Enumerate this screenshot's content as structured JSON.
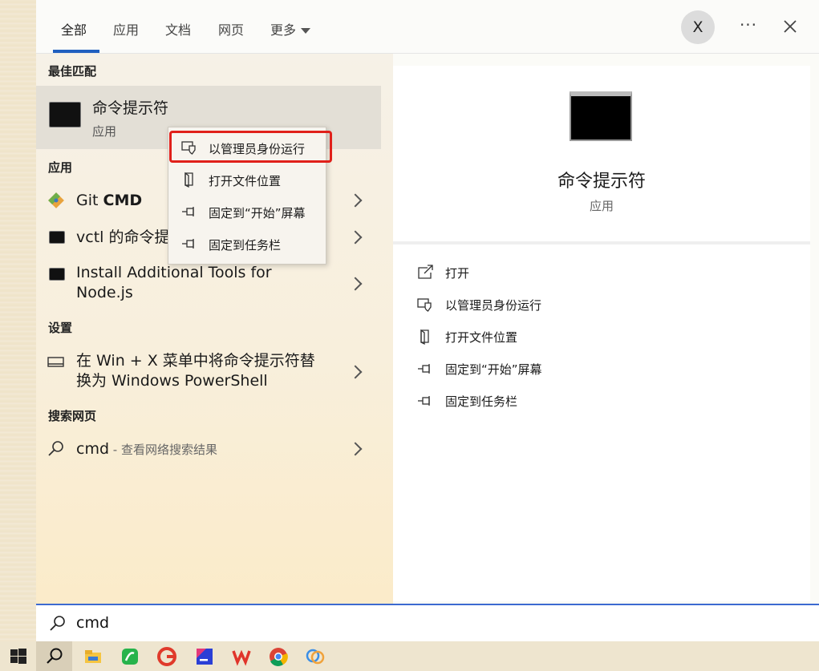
{
  "tabs": [
    {
      "label": "全部"
    },
    {
      "label": "应用"
    },
    {
      "label": "文档"
    },
    {
      "label": "网页"
    },
    {
      "label": "更多"
    }
  ],
  "header": {
    "avatar_letter": "X",
    "more_glyph": "···"
  },
  "sections": {
    "best_match": "最佳匹配",
    "apps": "应用",
    "settings": "设置",
    "web": "搜索网页"
  },
  "best_match": {
    "title": "命令提示符",
    "subtitle": "应用"
  },
  "apps": [
    {
      "plain": "Git ",
      "bold": "CMD"
    },
    {
      "label": "vctl 的命令提示"
    },
    {
      "label_line1": "Install Additional Tools for",
      "label_line2": "Node.js"
    }
  ],
  "settings_item": {
    "line1": "在 Win + X 菜单中将命令提示符替",
    "line2": "换为 Windows PowerShell"
  },
  "web_item": {
    "query": "cmd",
    "suffix": " - 查看网络搜索结果"
  },
  "context_menu": [
    {
      "label": "以管理员身份运行",
      "icon": "shield-icon"
    },
    {
      "label": "打开文件位置",
      "icon": "file-location-icon"
    },
    {
      "label": "固定到“开始”屏幕",
      "icon": "pin-icon"
    },
    {
      "label": "固定到任务栏",
      "icon": "pin-icon"
    }
  ],
  "detail": {
    "title": "命令提示符",
    "subtitle": "应用"
  },
  "detail_actions": [
    {
      "label": "打开",
      "icon": "open-icon"
    },
    {
      "label": "以管理员身份运行",
      "icon": "shield-icon"
    },
    {
      "label": "打开文件位置",
      "icon": "file-location-icon"
    },
    {
      "label": "固定到“开始”屏幕",
      "icon": "pin-icon"
    },
    {
      "label": "固定到任务栏",
      "icon": "pin-icon"
    }
  ],
  "search": {
    "value": "cmd"
  },
  "colors": {
    "accent": "#1f5fbf",
    "highlight": "#e0201a"
  }
}
